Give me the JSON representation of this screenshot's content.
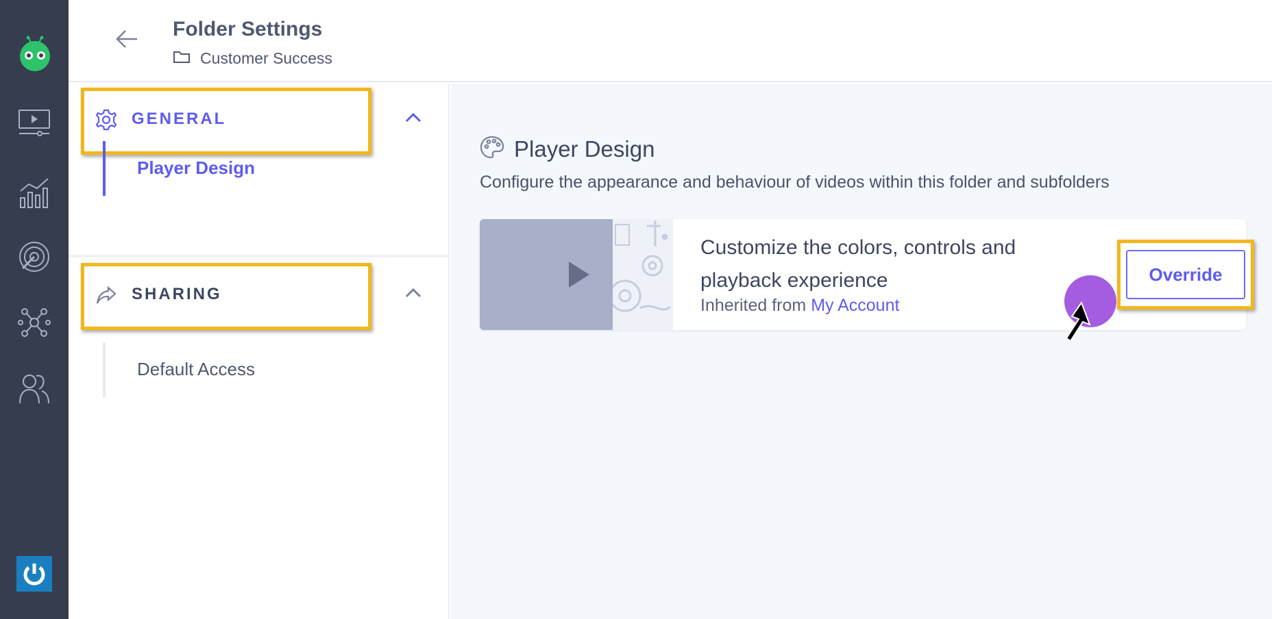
{
  "rail": {
    "items": [
      {
        "name": "videos",
        "icon": "video-player-icon"
      },
      {
        "name": "analytics",
        "icon": "analytics-chart-icon"
      },
      {
        "name": "engagement",
        "icon": "target-icon"
      },
      {
        "name": "integrations",
        "icon": "network-icon"
      },
      {
        "name": "users",
        "icon": "users-icon"
      }
    ],
    "logo_icon": "robot-logo-icon",
    "power_icon": "power-icon"
  },
  "header": {
    "title": "Folder Settings",
    "breadcrumb": "Customer Success",
    "back_icon": "arrow-left-icon",
    "folder_icon": "folder-icon"
  },
  "side": {
    "sections": [
      {
        "label": "GENERAL",
        "icon": "gear-icon",
        "expanded": true,
        "color": "#5d5cf0",
        "items": [
          {
            "label": "Player Design",
            "active": true
          }
        ]
      },
      {
        "label": "SHARING",
        "icon": "share-icon",
        "expanded": true,
        "color": "#3d4660",
        "items": [
          {
            "label": "Default Access",
            "active": false
          }
        ]
      }
    ]
  },
  "main": {
    "title": "Player Design",
    "title_icon": "palette-icon",
    "description": "Configure the appearance and behaviour of videos within this folder and subfolders",
    "card": {
      "headline": "Customize the colors, controls and playback experience",
      "inherited_prefix": "Inherited from",
      "inherited_link": "My Account",
      "button_label": "Override"
    }
  },
  "colors": {
    "rail_bg": "#363d4f",
    "accent": "#5d5cf0",
    "highlight": "#f2b81b",
    "click_indicator": "#a45de0",
    "main_bg": "#f4f7fc"
  }
}
